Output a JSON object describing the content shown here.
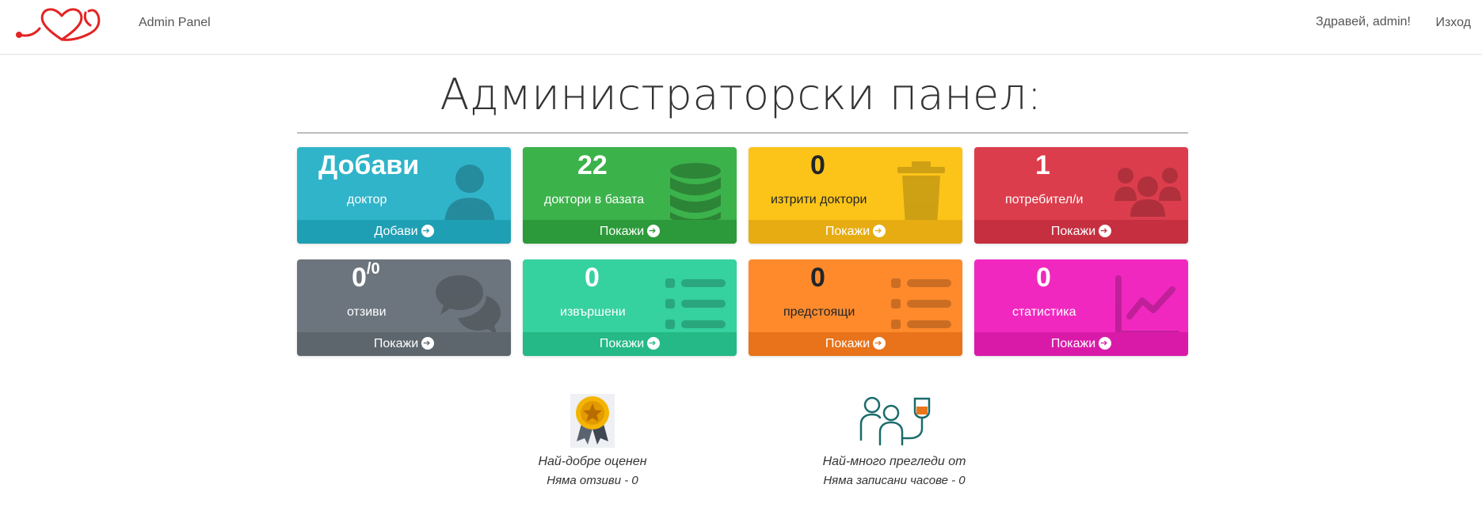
{
  "nav": {
    "brand": "Admin Panel",
    "greeting": "Здравей, admin!",
    "logout": "Изход",
    "logo_icon": "heart-stethoscope-logo",
    "logo_color": "#e32424"
  },
  "page": {
    "title": "Администраторски панел:"
  },
  "cards": [
    {
      "value": "Добави",
      "label": "доктор",
      "action": "Добави",
      "icon": "user-icon",
      "color": "#30b4c9"
    },
    {
      "value": "22",
      "label": "доктори в базата",
      "action": "Покажи",
      "icon": "database-icon",
      "color": "#3cb24b"
    },
    {
      "value": "0",
      "label": "изтрити доктори",
      "action": "Покажи",
      "icon": "trash-icon",
      "color": "#fcc419"
    },
    {
      "value": "1",
      "label": "потребител/и",
      "action": "Покажи",
      "icon": "users-icon",
      "color": "#dc3d4c"
    },
    {
      "value": "0",
      "value_sup": "/0",
      "label": "отзиви",
      "action": "Покажи",
      "icon": "comments-icon",
      "color": "#6c757d"
    },
    {
      "value": "0",
      "label": "извършени",
      "action": "Покажи",
      "icon": "list-icon",
      "color": "#35d19e"
    },
    {
      "value": "0",
      "label": "предстоящи",
      "action": "Покажи",
      "icon": "list-icon",
      "color": "#fe8a2c"
    },
    {
      "value": "0",
      "label": "статистика",
      "action": "Покажи",
      "icon": "chart-line-icon",
      "color": "#f128c0"
    }
  ],
  "stats": [
    {
      "title": "Най-добре оценен",
      "value": "Няма отзиви - 0",
      "icon": "award-medal-icon"
    },
    {
      "title": "Най-много прегледи от",
      "value": "Няма записани часове - 0",
      "icon": "patients-iv-icon"
    }
  ]
}
